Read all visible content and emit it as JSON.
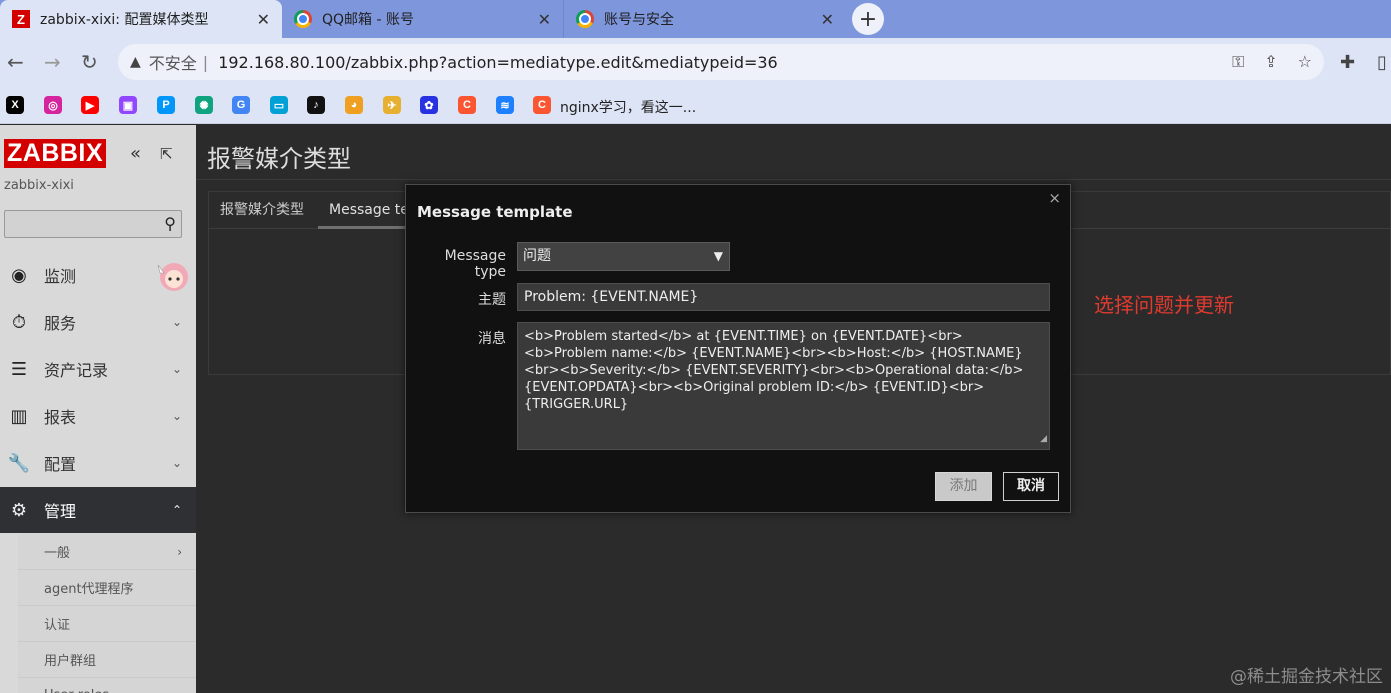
{
  "browser": {
    "tabs": [
      {
        "title": "zabbix-xixi: 配置媒体类型",
        "favicon": "zabbix-z-icon"
      },
      {
        "title": "QQ邮箱 - 账号",
        "favicon": "chrome-icon"
      },
      {
        "title": "账号与安全",
        "favicon": "chrome-icon"
      }
    ],
    "newtab_label": "+",
    "address": {
      "warning_label": "不安全",
      "separator": "|",
      "url": "192.168.80.100/zabbix.php?action=mediatype.edit&mediatypeid=36"
    },
    "bookmarks": [
      {
        "icon": "x-twitter-icon",
        "glyph": "X",
        "color": "#000000"
      },
      {
        "icon": "instagram-icon",
        "glyph": "◎",
        "color": "#d6249f"
      },
      {
        "icon": "youtube-icon",
        "glyph": "▶",
        "color": "#ff0000"
      },
      {
        "icon": "twitch-icon",
        "glyph": "▣",
        "color": "#9146ff"
      },
      {
        "icon": "pixiv-icon",
        "glyph": "P",
        "color": "#0096fa"
      },
      {
        "icon": "chatgpt-icon",
        "glyph": "✺",
        "color": "#10a37f"
      },
      {
        "icon": "google-icon",
        "glyph": "G",
        "color": "#4285f4"
      },
      {
        "icon": "bilibili-icon",
        "glyph": "▭",
        "color": "#00a1d6"
      },
      {
        "icon": "tiktok-icon",
        "glyph": "♪",
        "color": "#111111"
      },
      {
        "icon": "game-icon",
        "glyph": "◕",
        "color": "#f0a020"
      },
      {
        "icon": "wing-icon",
        "glyph": "✈",
        "color": "#e8b030"
      },
      {
        "icon": "baidu-icon",
        "glyph": "✿",
        "color": "#2932e1"
      },
      {
        "icon": "csdn-icon",
        "glyph": "C",
        "color": "#fc5531"
      },
      {
        "icon": "juejin-icon",
        "glyph": "≋",
        "color": "#1e80ff"
      },
      {
        "icon": "csdn-icon",
        "glyph": "C",
        "color": "#fc5531"
      }
    ],
    "bookmark_text": "nginx学习，看这一..."
  },
  "sidebar": {
    "logo": "ZABBIX",
    "hostname": "zabbix-xixi",
    "search_placeholder": "",
    "menu": [
      {
        "label": "监测",
        "icon": "eye-icon",
        "glyph": "◉",
        "chevron": ""
      },
      {
        "label": "服务",
        "icon": "stopwatch-icon",
        "glyph": "⏱",
        "chevron": "⌄"
      },
      {
        "label": "资产记录",
        "icon": "list-icon",
        "glyph": "☰",
        "chevron": "⌄"
      },
      {
        "label": "报表",
        "icon": "bar-chart-icon",
        "glyph": "▥",
        "chevron": "⌄"
      },
      {
        "label": "配置",
        "icon": "wrench-icon",
        "glyph": "🔧",
        "chevron": "⌄"
      },
      {
        "label": "管理",
        "icon": "gear-icon",
        "glyph": "⚙",
        "chevron": "⌃"
      }
    ],
    "submenu": [
      {
        "label": "一般",
        "chevron": "›"
      },
      {
        "label": "agent代理程序",
        "chevron": ""
      },
      {
        "label": "认证",
        "chevron": ""
      },
      {
        "label": "用户群组",
        "chevron": ""
      },
      {
        "label": "User roles",
        "chevron": ""
      }
    ]
  },
  "main": {
    "page_title": "报警媒介类型",
    "tabs": [
      {
        "label": "报警媒介类型"
      },
      {
        "label": "Message templates"
      }
    ]
  },
  "modal": {
    "title": "Message template",
    "close_label": "×",
    "message_type_label": "Message type",
    "message_type_value": "问题",
    "subject_label": "主题",
    "subject_value": "Problem: {EVENT.NAME}",
    "message_label": "消息",
    "message_value": "<b>Problem started</b> at {EVENT.TIME} on {EVENT.DATE}<br><b>Problem name:</b> {EVENT.NAME}<br><b>Host:</b> {HOST.NAME}<br><b>Severity:</b> {EVENT.SEVERITY}<br><b>Operational data:</b> {EVENT.OPDATA}<br><b>Original problem ID:</b> {EVENT.ID}<br>{TRIGGER.URL}",
    "add_label": "添加",
    "cancel_label": "取消"
  },
  "annotation": "选择问题并更新",
  "watermark": "@稀土掘金技术社区"
}
